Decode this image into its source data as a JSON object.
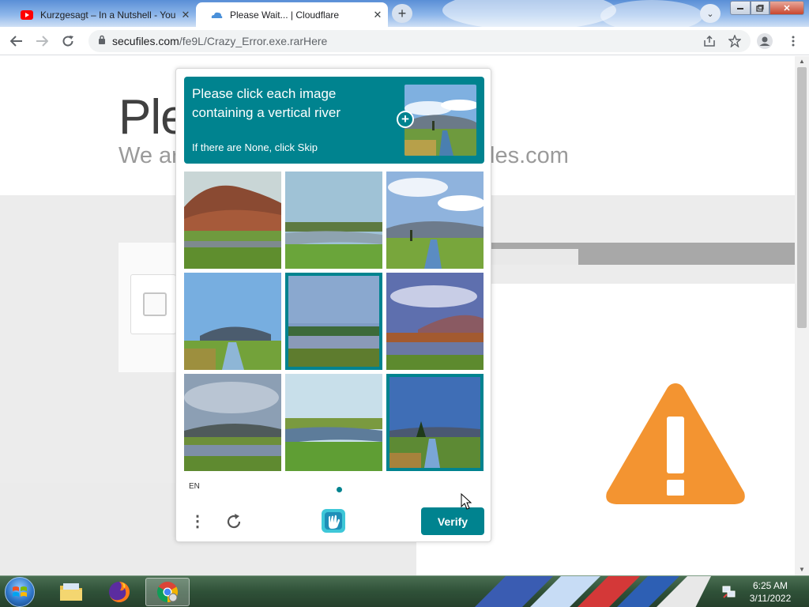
{
  "browser": {
    "tabs": [
      {
        "title": "Kurzgesagt – In a Nutshell - YouT",
        "favicon": "youtube-icon",
        "active": false
      },
      {
        "title": "Please Wait... | Cloudflare",
        "favicon": "cloudflare-icon",
        "active": true
      }
    ],
    "close_glyph": "✕",
    "new_tab_glyph": "+",
    "tab_search_glyph": "⌄",
    "url_host": "secufiles.com",
    "url_path": "/fe9L/Crazy_Error.exe.rarHere"
  },
  "page": {
    "heading": "Ple",
    "subline_left": "We ar",
    "subline_right": "les.com"
  },
  "captcha": {
    "prompt_line1": "Please click each image",
    "prompt_line2": "containing a vertical river",
    "prompt_sub": "If there are None, click Skip",
    "plus_glyph": "+",
    "language": "EN",
    "menu_glyph": "⋮",
    "verify_label": "Verify",
    "selected_tiles": [
      5,
      9
    ],
    "accent_color": "#00838f"
  },
  "taskbar": {
    "apps": [
      "windows-explorer",
      "firefox",
      "chrome"
    ],
    "clock_time": "6:25 AM",
    "clock_date": "3/11/2022"
  },
  "colors": {
    "warning": "#f39431",
    "teal": "#00838f"
  }
}
